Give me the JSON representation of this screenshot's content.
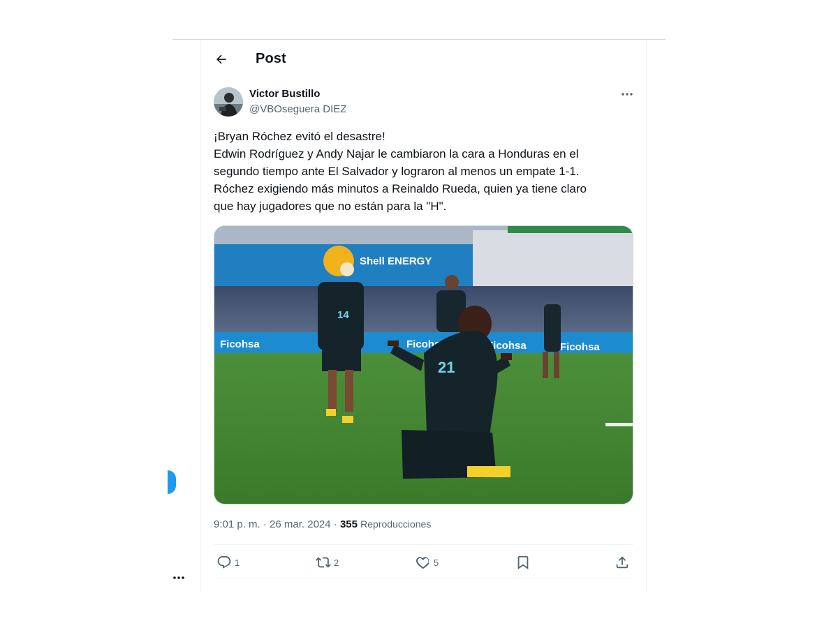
{
  "header": {
    "title": "Post"
  },
  "author": {
    "name": "Victor Bustillo",
    "handle": "@VBOseguera DIEZ"
  },
  "tweet": {
    "lines": [
      "¡Bryan Róchez evitó el desastre!",
      "Edwin Rodríguez y Andy Najar le cambiaron la cara a Honduras en el",
      "segundo tiempo ante El Salvador y lograron al menos un empate 1-1.",
      "Róchez exigiendo más minutos a Reinaldo Rueda, quien ya tiene claro",
      "que hay jugadores que no están para la \"H\"."
    ]
  },
  "media": {
    "banner_top": "Shell ENERGY",
    "ad_board": [
      "Ficohsa",
      "Ficohsa",
      "Ficohsa",
      "Ficohsa"
    ],
    "shirt_numbers": {
      "main": "21",
      "left": "14"
    }
  },
  "meta": {
    "time": "9:01 p. m.",
    "date": "26 mar. 2024",
    "views": "355",
    "views_label": "Reproducciones"
  },
  "actions": {
    "replies": "1",
    "reposts": "2",
    "likes": "5"
  },
  "colors": {
    "accent": "#1d9bf0",
    "text": "#0f1419",
    "muted": "#536471",
    "border": "#eff3f4"
  },
  "icons": [
    "back-arrow-icon",
    "more-icon",
    "reply-icon",
    "repost-icon",
    "like-icon",
    "bookmark-icon",
    "share-icon"
  ]
}
